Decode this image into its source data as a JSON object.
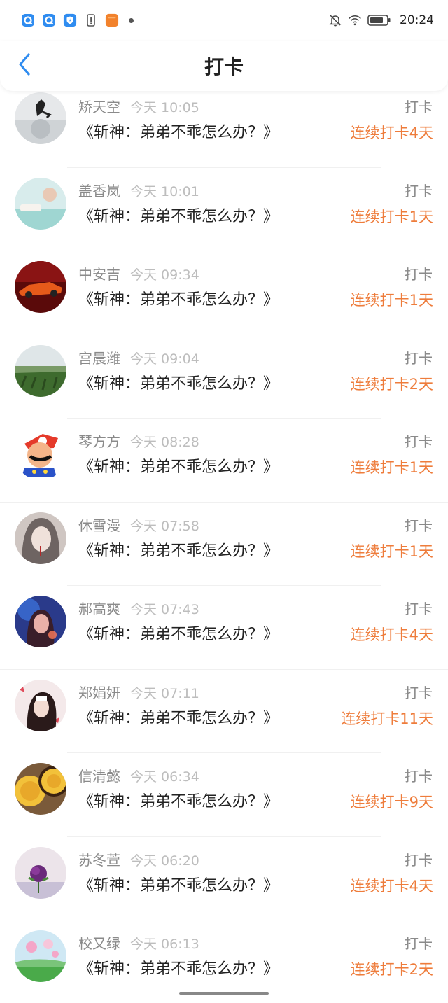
{
  "status_bar": {
    "time": "20:24",
    "icons_left": [
      "q-app-icon",
      "q-app-icon",
      "shield-app-icon",
      "sim-alert-icon",
      "orange-app-icon",
      "more-dot-icon"
    ],
    "icons_right": [
      "bell-muted-icon",
      "wifi-icon",
      "battery-icon"
    ]
  },
  "nav": {
    "back_icon": "chevron-left-icon",
    "title": "打卡"
  },
  "colors": {
    "accent_blue": "#2f8cf0",
    "streak_orange": "#ee7c3b",
    "muted_text": "#8a8a8a",
    "time_text": "#bdbdbd"
  },
  "entries": [
    {
      "name": "矫天空",
      "time": "今天 10:05",
      "book": "《斩神：弟弟不乖怎么办？》",
      "label": "打卡",
      "streak": "连续打卡4天"
    },
    {
      "name": "盖香岚",
      "time": "今天 10:01",
      "book": "《斩神：弟弟不乖怎么办？》",
      "label": "打卡",
      "streak": "连续打卡1天"
    },
    {
      "name": "中安吉",
      "time": "今天 09:34",
      "book": "《斩神：弟弟不乖怎么办？》",
      "label": "打卡",
      "streak": "连续打卡1天"
    },
    {
      "name": "宫晨潍",
      "time": "今天 09:04",
      "book": "《斩神：弟弟不乖怎么办？》",
      "label": "打卡",
      "streak": "连续打卡2天"
    },
    {
      "name": "琴方方",
      "time": "今天 08:28",
      "book": "《斩神：弟弟不乖怎么办？》",
      "label": "打卡",
      "streak": "连续打卡1天"
    },
    {
      "name": "休雪漫",
      "time": "今天 07:58",
      "book": "《斩神：弟弟不乖怎么办？》",
      "label": "打卡",
      "streak": "连续打卡1天"
    },
    {
      "name": "郝高爽",
      "time": "今天 07:43",
      "book": "《斩神：弟弟不乖怎么办？》",
      "label": "打卡",
      "streak": "连续打卡4天"
    },
    {
      "name": "郑娟妍",
      "time": "今天 07:11",
      "book": "《斩神：弟弟不乖怎么办？》",
      "label": "打卡",
      "streak": "连续打卡11天"
    },
    {
      "name": "信清懿",
      "time": "今天 06:34",
      "book": "《斩神：弟弟不乖怎么办？》",
      "label": "打卡",
      "streak": "连续打卡9天"
    },
    {
      "name": "苏冬萱",
      "time": "今天 06:20",
      "book": "《斩神：弟弟不乖怎么办？》",
      "label": "打卡",
      "streak": "连续打卡4天"
    },
    {
      "name": "校又绿",
      "time": "今天 06:13",
      "book": "《斩神：弟弟不乖怎么办？》",
      "label": "打卡",
      "streak": "连续打卡2天"
    }
  ]
}
